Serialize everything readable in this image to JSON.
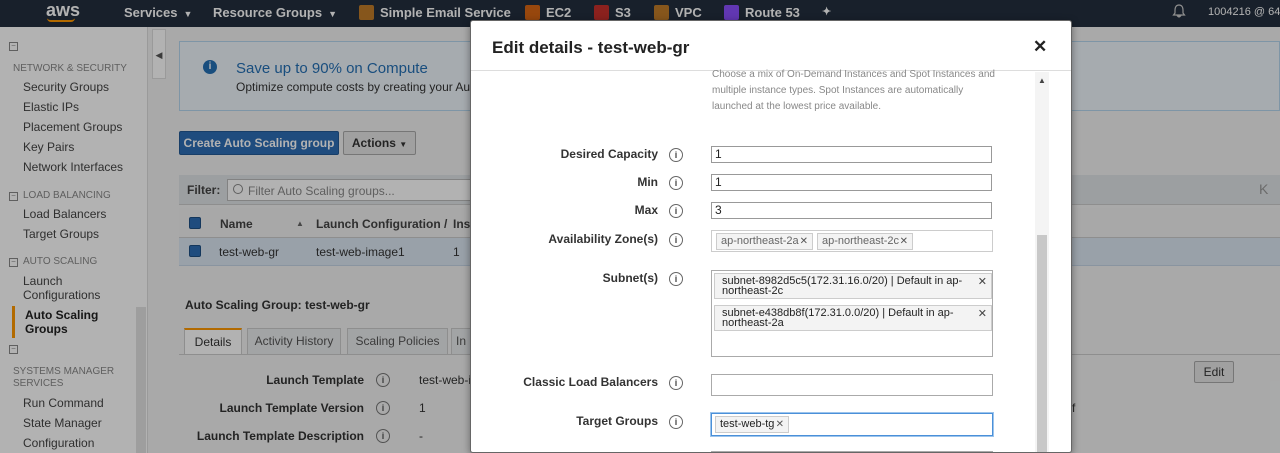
{
  "topnav": {
    "logo": "aws",
    "services": "Services",
    "resource_groups": "Resource Groups",
    "ses": "Simple Email Service",
    "ec2": "EC2",
    "s3": "S3",
    "vpc": "VPC",
    "route53": "Route 53",
    "account": "1004216 @ 64"
  },
  "sidebar": {
    "net_sec_head": "NETWORK & SECURITY",
    "security_groups": "Security Groups",
    "elastic_ips": "Elastic IPs",
    "placement_groups": "Placement Groups",
    "key_pairs": "Key Pairs",
    "network_interfaces": "Network Interfaces",
    "lb_head": "LOAD BALANCING",
    "load_balancers": "Load Balancers",
    "target_groups": "Target Groups",
    "as_head": "AUTO SCALING",
    "launch_configs_1": "Launch",
    "launch_configs_2": "Configurations",
    "as_groups_1": "Auto Scaling",
    "as_groups_2": "Groups",
    "sm_head_1": "SYSTEMS MANAGER",
    "sm_head_2": "SERVICES",
    "run_command": "Run Command",
    "state_manager": "State Manager",
    "configuration": "Configuration"
  },
  "banner": {
    "title": "Save up to 90% on Compute",
    "desc": "Optimize compute costs by creating your Auto"
  },
  "toolbar": {
    "create": "Create Auto Scaling group",
    "actions": "Actions"
  },
  "filter": {
    "label": "Filter:",
    "placeholder": "Filter Auto Scaling groups...",
    "pager": "K"
  },
  "table": {
    "headers": [
      "Name",
      "Launch Configuration /",
      "Ins"
    ],
    "row": [
      "test-web-gr",
      "test-web-image1",
      "1"
    ]
  },
  "details": {
    "title": "Auto Scaling Group: test-web-gr",
    "tabs": [
      "Details",
      "Activity History",
      "Scaling Policies",
      "In"
    ],
    "rows": [
      {
        "label": "Launch Template",
        "value": "test-web-i"
      },
      {
        "label": "Launch Template Version",
        "value": "1"
      },
      {
        "label": "Launch Template Description",
        "value": "-"
      }
    ],
    "edit": "Edit",
    "right_fragment": "f"
  },
  "modal": {
    "title": "Edit details - test-web-gr",
    "close": "✕",
    "help_text": "Choose a mix of On-Demand Instances and Spot Instances and multiple instance types. Spot Instances are automatically launched at the lowest price available.",
    "desired_capacity_label": "Desired Capacity",
    "desired_capacity": "1",
    "min_label": "Min",
    "min": "1",
    "max_label": "Max",
    "max": "3",
    "az_label": "Availability Zone(s)",
    "az": [
      "ap-northeast-2a",
      "ap-northeast-2c"
    ],
    "subnet_label": "Subnet(s)",
    "subnets": [
      "subnet-8982d5c5(172.31.16.0/20) | Default in ap-northeast-2c",
      "subnet-e438db8f(172.31.0.0/20) | Default in ap-northeast-2a"
    ],
    "clb_label": "Classic Load Balancers",
    "tg_label": "Target Groups",
    "target_groups": [
      "test-web-tg"
    ]
  },
  "colors": {
    "nav_bg": "#232f3e",
    "accent": "#ff9900",
    "primary": "#2d6db5"
  }
}
